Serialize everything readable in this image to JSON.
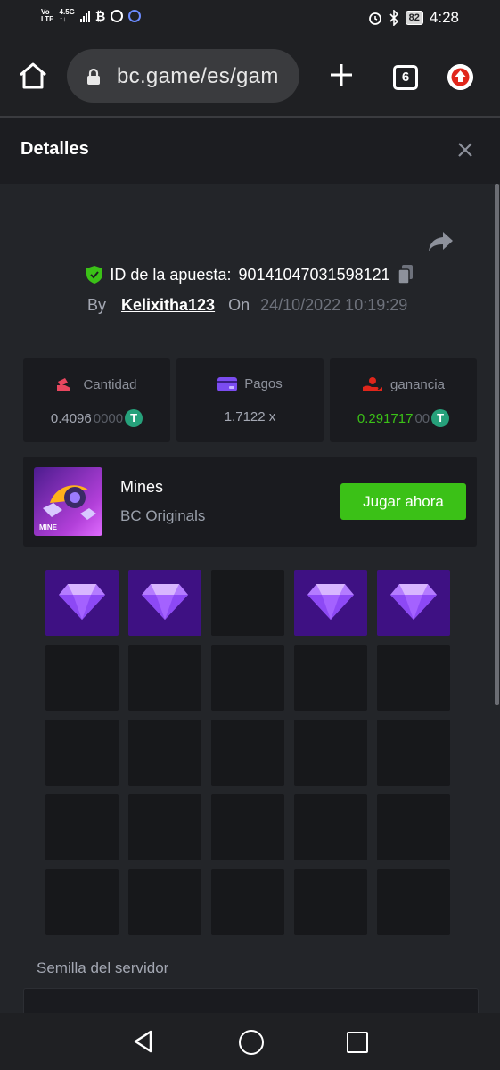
{
  "status_bar": {
    "carrier_top": "Vo",
    "carrier_bottom": "LTE",
    "network_top": "4.5G",
    "network_bottom": "↑↓",
    "battery": "82",
    "time": "4:28"
  },
  "browser": {
    "url": "bc.game/es/gam",
    "tab_count": "6"
  },
  "modal": {
    "title": "Detalles"
  },
  "bet": {
    "id_label": "ID de la apuesta:",
    "id_value": "90141047031598121",
    "by_label": "By",
    "user": "Kelixitha123",
    "on_label": "On",
    "datetime": "24/10/2022 10:19:29"
  },
  "stats": {
    "amount": {
      "label": "Cantidad",
      "value": "0.4096",
      "value_dim": "0000",
      "currency_icon": "tether-icon"
    },
    "payout": {
      "label": "Pagos",
      "value": "1.7122 x"
    },
    "profit": {
      "label": "ganancia",
      "value": "0.291717",
      "value_dim": "00",
      "currency_icon": "tether-icon"
    }
  },
  "game": {
    "name": "Mines",
    "provider": "BC Originals",
    "thumb_label": "MINE",
    "play_label": "Jugar ahora"
  },
  "board": {
    "rows": 5,
    "cols": 5,
    "revealed_gems": [
      0,
      1,
      3,
      4
    ]
  },
  "seed": {
    "label": "Semilla del servidor"
  },
  "colors": {
    "accent_green": "#3bc117",
    "gem_tile": "#3e1183",
    "tether": "#26a17b"
  }
}
